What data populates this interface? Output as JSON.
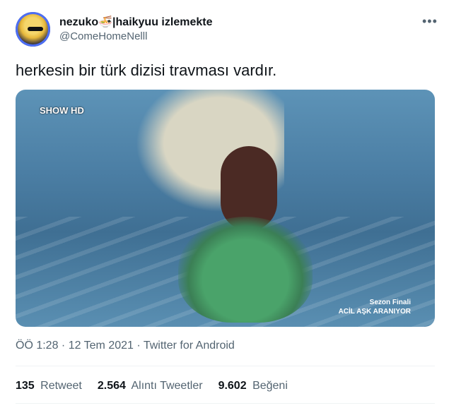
{
  "user": {
    "display_name": "nezuko🍜|haikyuu izlemekte",
    "handle": "@ComeHomeNelll"
  },
  "tweet": {
    "text": "herkesin bir türk dizisi travması vardır.",
    "meta": "ÖÖ 1:28 · 12 Tem 2021 · Twitter for Android"
  },
  "media": {
    "logo": "SHOW HD",
    "caption_line1": "Sezon Finali",
    "caption_line2": "ACİL AŞK ARANIYOR"
  },
  "stats": {
    "retweets_count": "135",
    "retweets_label": "Retweet",
    "quotes_count": "2.564",
    "quotes_label": "Alıntı Tweetler",
    "likes_count": "9.602",
    "likes_label": "Beğeni"
  },
  "icons": {
    "more": "more-horizontal-icon"
  }
}
